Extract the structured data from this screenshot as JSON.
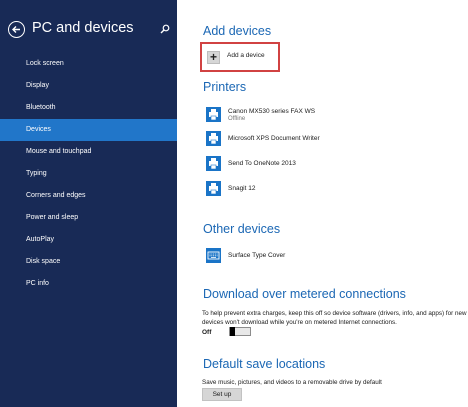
{
  "sidebar": {
    "title": "PC and devices",
    "back_icon": "back-arrow-icon",
    "search_icon": "search-icon",
    "items": [
      {
        "label": "Lock screen",
        "active": false
      },
      {
        "label": "Display",
        "active": false
      },
      {
        "label": "Bluetooth",
        "active": false
      },
      {
        "label": "Devices",
        "active": true
      },
      {
        "label": "Mouse and touchpad",
        "active": false
      },
      {
        "label": "Typing",
        "active": false
      },
      {
        "label": "Corners and edges",
        "active": false
      },
      {
        "label": "Power and sleep",
        "active": false
      },
      {
        "label": "AutoPlay",
        "active": false
      },
      {
        "label": "Disk space",
        "active": false
      },
      {
        "label": "PC info",
        "active": false
      }
    ]
  },
  "main": {
    "add_devices": {
      "title": "Add devices",
      "button_label": "Add a device",
      "button_icon": "plus-icon"
    },
    "printers": {
      "title": "Printers",
      "items": [
        {
          "name": "Canon MX530 series FAX WS",
          "status": "Offline",
          "icon": "printer-icon"
        },
        {
          "name": "Microsoft XPS Document Writer",
          "status": "",
          "icon": "printer-icon"
        },
        {
          "name": "Send To OneNote 2013",
          "status": "",
          "icon": "printer-icon"
        },
        {
          "name": "Snagit 12",
          "status": "",
          "icon": "printer-icon"
        }
      ]
    },
    "other_devices": {
      "title": "Other devices",
      "items": [
        {
          "name": "Surface Type Cover",
          "icon": "keyboard-icon"
        }
      ]
    },
    "metered": {
      "title": "Download over metered connections",
      "description_line1": "To help prevent extra charges, keep this off so device software (drivers, info, and apps) for new",
      "description_line2": "devices won't download while you're on metered Internet connections.",
      "toggle_label": "Off",
      "toggle_on": false
    },
    "save_locations": {
      "title": "Default save locations",
      "description": "Save music, pictures, and videos to a removable drive by default",
      "button_label": "Set up"
    }
  },
  "colors": {
    "sidebar_bg": "#182a56",
    "active_item_bg": "#2176c9",
    "section_title": "#1b67b4",
    "device_icon_bg": "#1a74c7",
    "highlight_border": "#d14242"
  }
}
